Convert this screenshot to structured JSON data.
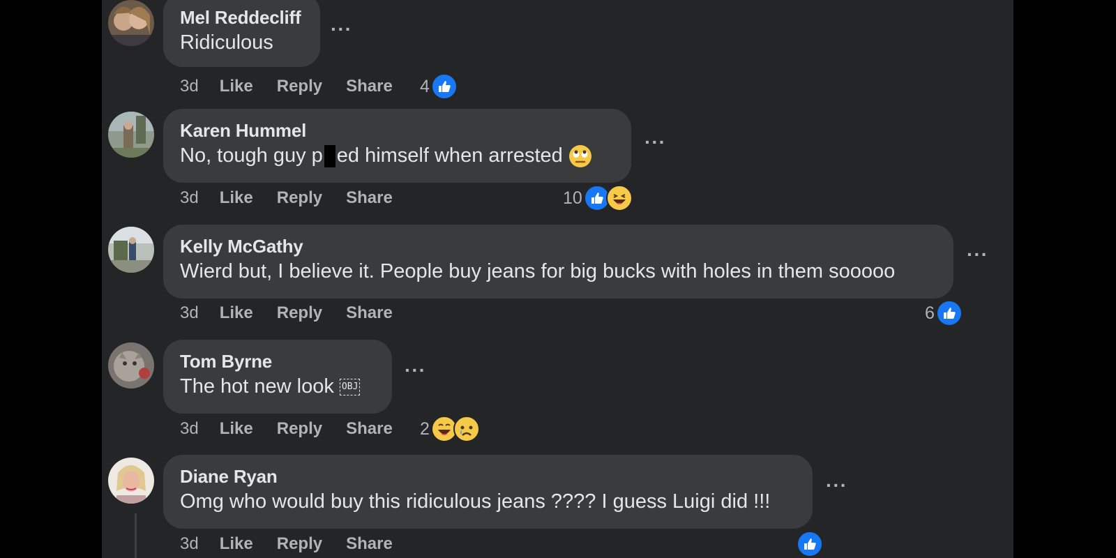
{
  "comments": [
    {
      "name": "Mel Reddecliff",
      "text": "Ridiculous",
      "time": "3d",
      "like": "Like",
      "reply": "Reply",
      "share": "Share",
      "count": "4"
    },
    {
      "name": "Karen Hummel",
      "text_a": "No, tough guy p",
      "text_b": "ed himself when arrested",
      "time": "3d",
      "like": "Like",
      "reply": "Reply",
      "share": "Share",
      "count": "10"
    },
    {
      "name": "Kelly McGathy",
      "text": "Wierd but, I believe it. People buy jeans for big bucks with holes in them sooooo",
      "time": "3d",
      "like": "Like",
      "reply": "Reply",
      "share": "Share",
      "count": "6"
    },
    {
      "name": "Tom Byrne",
      "text": "The hot new look",
      "obj": "OBJ",
      "time": "3d",
      "like": "Like",
      "reply": "Reply",
      "share": "Share",
      "count": "2"
    },
    {
      "name": "Diane Ryan",
      "text": "Omg who would buy this ridiculous jeans ???? I guess Luigi did !!!",
      "time": "3d",
      "like": "Like",
      "reply": "Reply",
      "share": "Share"
    }
  ],
  "more_label": "···",
  "colors": {
    "background": "#242526",
    "bubble": "#3a3b3c",
    "like": "#1877f2",
    "text": "#e4e6eb",
    "muted": "#b0b3b8"
  },
  "icons": [
    "more-options-icon",
    "like-reaction-icon",
    "haha-reaction-icon",
    "sad-reaction-icon",
    "roll-eyes-emoji"
  ]
}
